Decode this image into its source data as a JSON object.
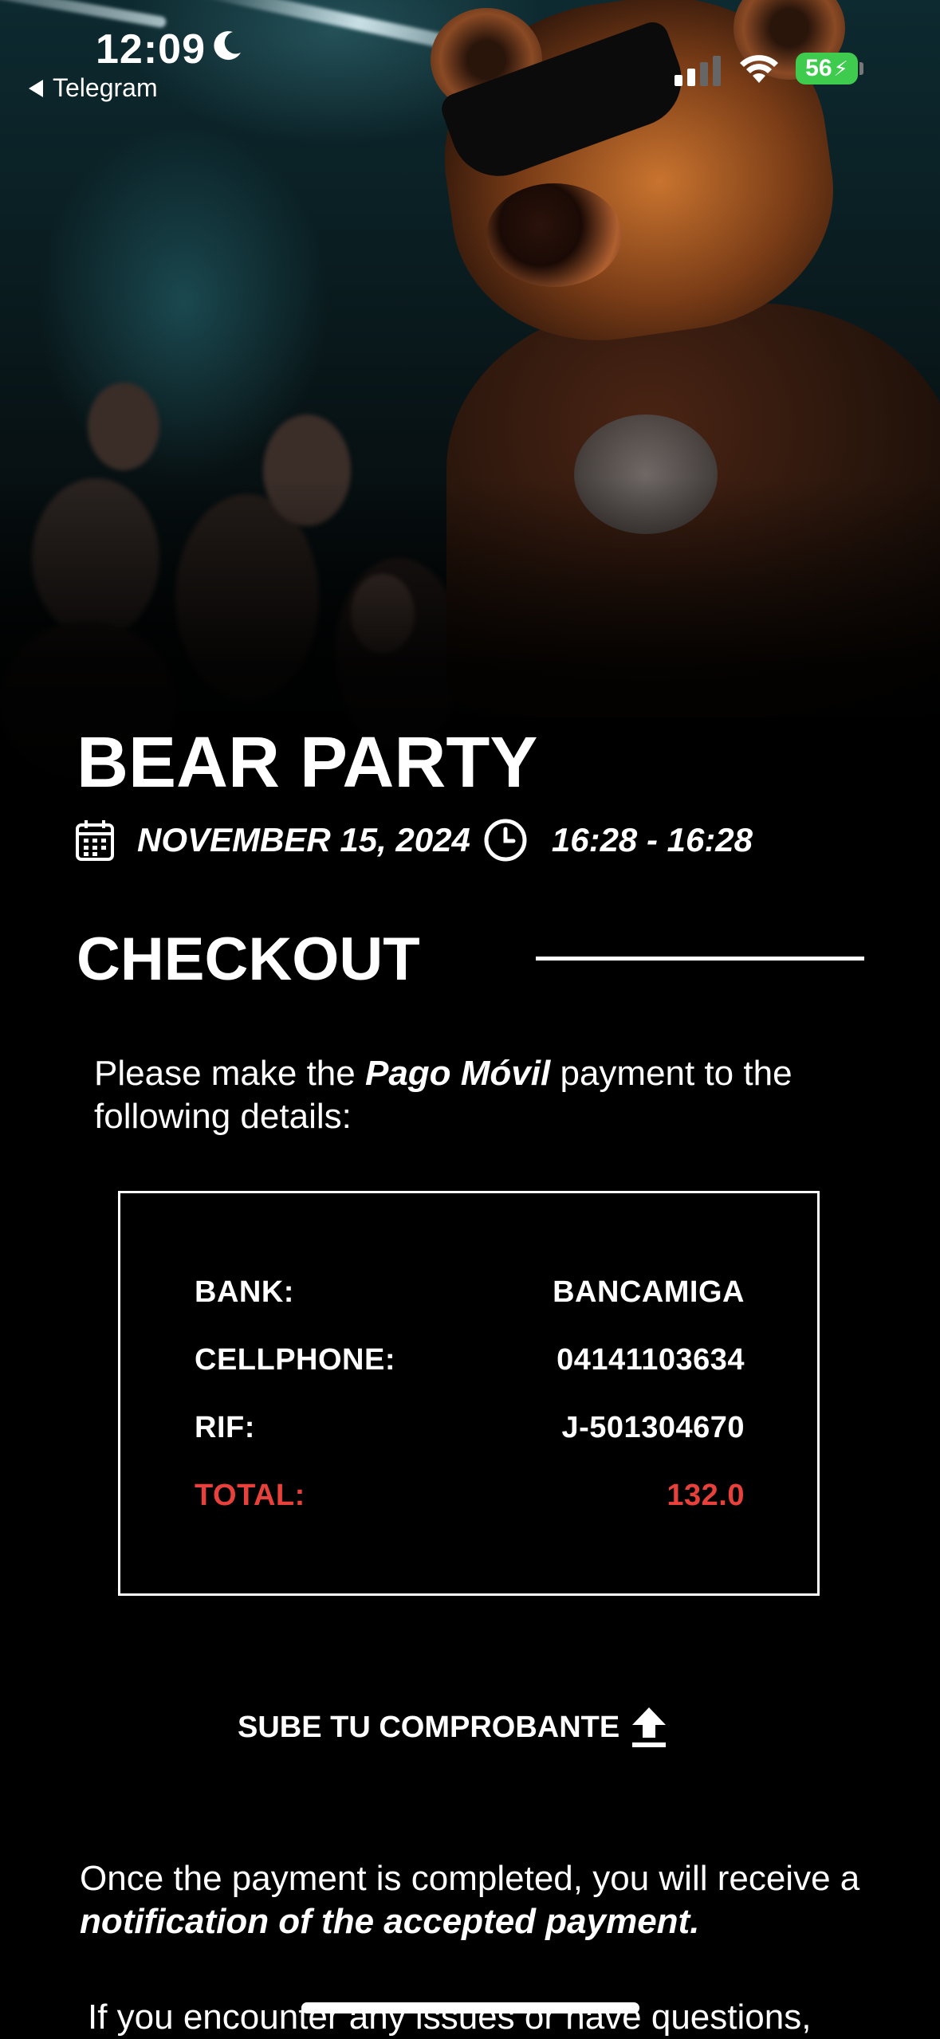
{
  "status_bar": {
    "time": "12:09",
    "back_app": "Telegram",
    "battery": "56"
  },
  "event": {
    "title": "BEAR PARTY",
    "date": "NOVEMBER 15, 2024",
    "hours": "16:28 - 16:28"
  },
  "checkout": {
    "heading": "CHECKOUT",
    "instruction_prefix": "Please make the",
    "instruction_method": "Pago Móvil",
    "instruction_suffix": "payment to the following details:",
    "rows": [
      {
        "label": "BANK:",
        "value": "BANCAMIGA"
      },
      {
        "label": "CELLPHONE:",
        "value": "04141103634"
      },
      {
        "label": "RIF:",
        "value": "J-501304670"
      },
      {
        "label": "TOTAL:",
        "value": "132.0"
      }
    ],
    "upload_label": "SUBE TU COMPROBANTE",
    "note_prefix": "Once the payment is completed, you will receive a",
    "note_emphasis": "notification of the accepted payment.",
    "help_text": "If you encounter any issues or have questions,"
  },
  "colors": {
    "background": "#000000",
    "text": "#ffffff",
    "total_accent": "#e8403a",
    "battery": "#3ecb4e"
  },
  "icons": [
    "moon-icon",
    "back-arrow-icon",
    "cellular-signal-icon",
    "wifi-icon",
    "battery-icon",
    "calendar-icon",
    "clock-icon",
    "upload-icon"
  ]
}
